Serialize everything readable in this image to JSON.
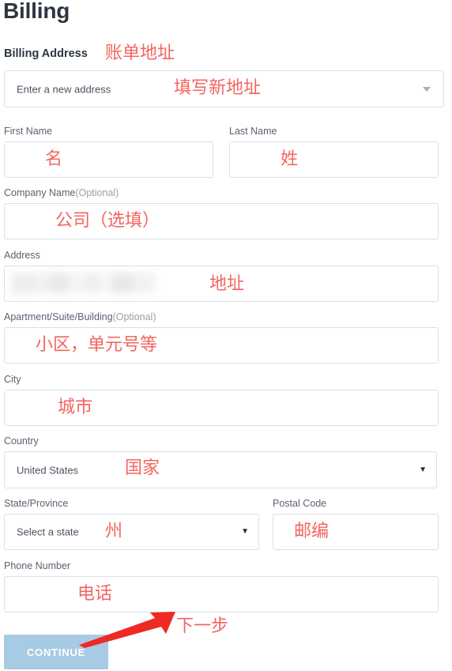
{
  "page": {
    "title": "Billing",
    "section_title": "Billing Address"
  },
  "colors": {
    "annotation_red": "#f4645f",
    "arrow_red": "#ee2a22",
    "button_blue": "#a7cbe4",
    "heading": "#2c3542",
    "label": "#5a6270",
    "optional": "#9aa1ab",
    "border": "#dcdfe3"
  },
  "address_select": {
    "label": "",
    "value": "Enter a new address",
    "icon": "chevron-down-icon"
  },
  "fields": {
    "first_name": {
      "label": "First Name",
      "value": ""
    },
    "last_name": {
      "label": "Last Name",
      "value": ""
    },
    "company_name": {
      "label": "Company Name",
      "optional": "(Optional)",
      "value": ""
    },
    "address": {
      "label": "Address",
      "value": ""
    },
    "apartment": {
      "label": "Apartment/Suite/Building",
      "optional": "(Optional)",
      "value": ""
    },
    "city": {
      "label": "City",
      "value": ""
    },
    "country": {
      "label": "Country",
      "value": "United States",
      "icon": "caret-down-icon"
    },
    "state": {
      "label": "State/Province",
      "value": "Select a state",
      "icon": "caret-down-icon"
    },
    "postal_code": {
      "label": "Postal Code",
      "value": ""
    },
    "phone_number": {
      "label": "Phone Number",
      "value": ""
    }
  },
  "button": {
    "continue_label": "CONTINUE"
  },
  "annotations": {
    "billing_address": "账单地址",
    "new_address": "填写新地址",
    "first_name": "名",
    "last_name": "姓",
    "company": "公司（选填）",
    "address": "地址",
    "apartment": "小区，单元号等",
    "city": "城市",
    "country": "国家",
    "state": "州",
    "postal_code": "邮编",
    "phone": "电话",
    "next_step": "下一步"
  }
}
